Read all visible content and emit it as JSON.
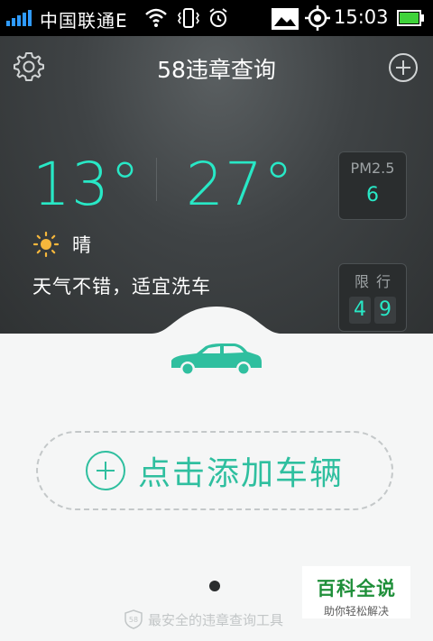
{
  "status_bar": {
    "carrier": "中国联通E",
    "time": "15:03",
    "icons": [
      "signal-icon",
      "wifi-icon",
      "vibrate-icon",
      "alarm-icon",
      "image-icon",
      "gps-icon",
      "battery-icon"
    ]
  },
  "header": {
    "title": "58违章查询",
    "left_icon": "gear-icon",
    "right_icon": "add-icon"
  },
  "weather": {
    "temp_low": "13°",
    "temp_high": "27°",
    "condition_icon": "sun-icon",
    "condition": "晴",
    "advice": "天气不错，适宜洗车",
    "pm_label": "PM2.5",
    "pm_value": "6",
    "limit_label": "限行",
    "limit_digits": [
      "4",
      "9"
    ]
  },
  "main": {
    "add_vehicle_label": "点击添加车辆",
    "pager_active_index": 0
  },
  "footer": {
    "badge": "58",
    "text": "最安全的违章查询工具"
  },
  "watermark": {
    "main": "百科全说",
    "sub": "助你轻松解决"
  },
  "colors": {
    "accent": "#28e8c6",
    "green": "#2fbf9f",
    "dark_bg": "#3f4345"
  }
}
